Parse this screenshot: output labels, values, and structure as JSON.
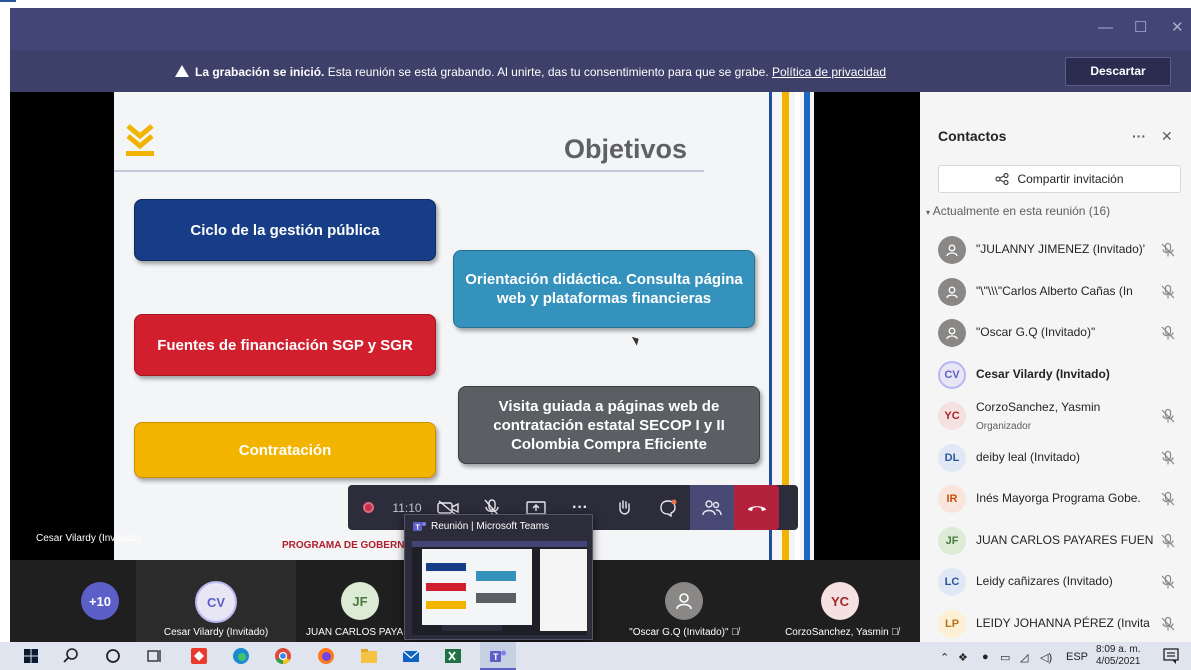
{
  "window": {
    "minimize_glyph": "—",
    "maximize_glyph": "☐",
    "close_glyph": "✕"
  },
  "banner": {
    "bold": "La grabación se inició.",
    "text": " Esta reunión se está grabando. Al unirte, das tu consentimiento para que se grabe. ",
    "link": "Política de privacidad",
    "dismiss": "Descartar"
  },
  "slide": {
    "title": "Objetivos",
    "boxes": {
      "ciclo": "Ciclo de la gestión pública",
      "fuentes": "Fuentes de financiación SGP y SGR",
      "contratacion": "Contratación",
      "orientacion": "Orientación didáctica. Consulta página web y plataformas financieras",
      "visita": "Visita guiada a páginas web de contratación estatal SECOP I y II Colombia Compra Eficiente"
    },
    "footer": "PROGRAMA DE GOBERNA",
    "speaker": "Cesar Vilardy (Invitado)"
  },
  "controls": {
    "timer": "11:10",
    "more": "···"
  },
  "preview": {
    "title": "Reunión | Microsoft Teams"
  },
  "gallery": [
    {
      "avatar": "+10",
      "name": "",
      "color": "#5b5fc7",
      "text_color": "#ffffff"
    },
    {
      "avatar": "CV",
      "name": "Cesar Vilardy (Invitado)",
      "color": "#e8e6f5",
      "text_color": "#5b5fc7"
    },
    {
      "avatar": "JF",
      "name": "JUAN CARLOS PAYAR",
      "color": "#dcebd6",
      "text_color": "#4a7a3d"
    },
    {
      "avatar": "",
      "name": "\"Oscar G.Q (Invitado)\"",
      "color": "#8a8886",
      "text_color": "#ffffff"
    },
    {
      "avatar": "YC",
      "name": "CorzoSanchez, Yasmin",
      "color": "#f5e1e1",
      "text_color": "#a4262c"
    }
  ],
  "panel": {
    "title": "Contactos",
    "more": "···",
    "close": "✕",
    "share": "Compartir invitación",
    "section": "Actualmente en esta reunión (16)",
    "participants": [
      {
        "initials": "",
        "name": "\"JULANNY JIMENEZ (Invitado)'",
        "role": "",
        "bg": "#8a8886",
        "fg": "#ffffff",
        "bold": false,
        "muted": true
      },
      {
        "initials": "",
        "name": "\"\\\"\\\\\\\"Carlos Alberto Cañas (In",
        "role": "",
        "bg": "#8a8886",
        "fg": "#ffffff",
        "bold": false,
        "muted": true
      },
      {
        "initials": "",
        "name": "\"Oscar G.Q (Invitado)\"",
        "role": "",
        "bg": "#8a8886",
        "fg": "#ffffff",
        "bold": false,
        "muted": true
      },
      {
        "initials": "CV",
        "name": "Cesar Vilardy (Invitado)",
        "role": "",
        "bg": "#e8e6f5",
        "fg": "#5b5fc7",
        "bold": true,
        "muted": false
      },
      {
        "initials": "YC",
        "name": "CorzoSanchez, Yasmin",
        "role": "Organizador",
        "bg": "#f5e1e1",
        "fg": "#a4262c",
        "bold": false,
        "muted": true
      },
      {
        "initials": "DL",
        "name": "deiby leal (Invitado)",
        "role": "",
        "bg": "#e1e8f5",
        "fg": "#2b579a",
        "bold": false,
        "muted": true
      },
      {
        "initials": "IR",
        "name": "Inés Mayorga Programa Gobe.",
        "role": "",
        "bg": "#f9e5dc",
        "fg": "#ca5010",
        "bold": false,
        "muted": true
      },
      {
        "initials": "JF",
        "name": "JUAN CARLOS PAYARES FUEN.",
        "role": "",
        "bg": "#dcebd6",
        "fg": "#4a7a3d",
        "bold": false,
        "muted": true
      },
      {
        "initials": "LC",
        "name": "Leidy cañizares (Invitado)",
        "role": "",
        "bg": "#e1e8f5",
        "fg": "#2b579a",
        "bold": false,
        "muted": true
      },
      {
        "initials": "LP",
        "name": "LEIDY JOHANNA PÉREZ (Invita",
        "role": "",
        "bg": "#fdf0d5",
        "fg": "#b7721a",
        "bold": false,
        "muted": true
      }
    ]
  },
  "taskbar": {
    "lang": "ESP",
    "time": "8:09 a. m.",
    "date": "4/05/2021"
  }
}
